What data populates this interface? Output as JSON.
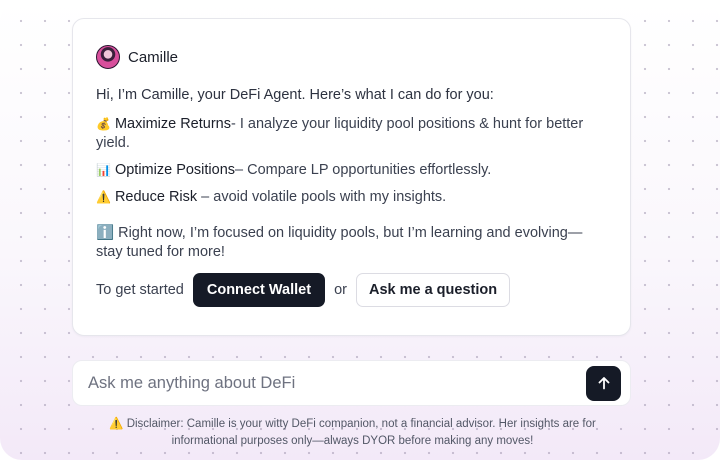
{
  "agent": {
    "name": "Camille",
    "avatar_icon": "avatar-icon"
  },
  "message": {
    "intro": "Hi, I’m Camille, your DeFi Agent. Here’s what I can do for you:",
    "features": [
      {
        "emoji": "💰",
        "icon": "money-bag-icon",
        "title": "Maximize Returns",
        "text": "- I analyze your liquidity pool positions & hunt for better yield."
      },
      {
        "emoji": "📊",
        "icon": "bar-chart-icon",
        "title": "Optimize Positions",
        "text": "– Compare LP opportunities effortlessly."
      },
      {
        "emoji": "⚠️",
        "icon": "warning-icon",
        "title": "Reduce Risk",
        "text": " – avoid volatile pools with my insights."
      }
    ],
    "note_emoji": "ℹ️",
    "note": " Right now, I’m focused on liquidity pools, but I’m learning and evolving—stay tuned for more!",
    "cta_text": "To get started",
    "connect_label": "Connect Wallet",
    "or_text": "or",
    "ask_label": "Ask me a question"
  },
  "composer": {
    "placeholder": "Ask me anything about DeFi",
    "send_icon": "arrow-up-icon"
  },
  "disclaimer": {
    "emoji": "⚠️",
    "text": " Disclaimer: Camille is your witty DeFi companion, not a financial advisor. Her insights are for informational purposes only—always DYOR before making any moves!"
  },
  "colors": {
    "primary_button": "#151a26",
    "card_border": "#e6e6ec",
    "background_tint": "#f3e9f8"
  }
}
